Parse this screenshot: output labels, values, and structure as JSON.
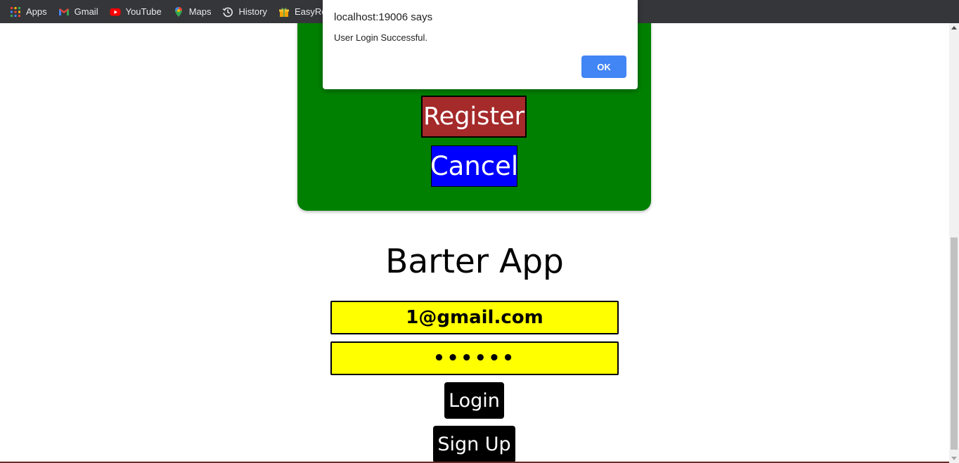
{
  "bookmarks": [
    {
      "label": "Apps",
      "icon": "apps-grid-icon"
    },
    {
      "label": "Gmail",
      "icon": "gmail-icon"
    },
    {
      "label": "YouTube",
      "icon": "youtube-icon"
    },
    {
      "label": "Maps",
      "icon": "maps-pin-icon"
    },
    {
      "label": "History",
      "icon": "history-icon"
    },
    {
      "label": "EasyRewa",
      "icon": "easyrewards-icon"
    }
  ],
  "dialog": {
    "title": "localhost:19006 says",
    "message": "User Login Successful.",
    "ok_label": "OK"
  },
  "register_panel": {
    "register_label": "Register",
    "cancel_label": "Cancel"
  },
  "login": {
    "title": "Barter App",
    "email_value": "1@gmail.com",
    "password_value": "••••••",
    "login_label": "Login",
    "signup_label": "Sign Up"
  },
  "colors": {
    "panel_green": "#008000",
    "register_brown": "#a52a2a",
    "cancel_blue": "#0000ff",
    "input_yellow": "#ffff00",
    "dialog_button_blue": "#4285f4"
  }
}
